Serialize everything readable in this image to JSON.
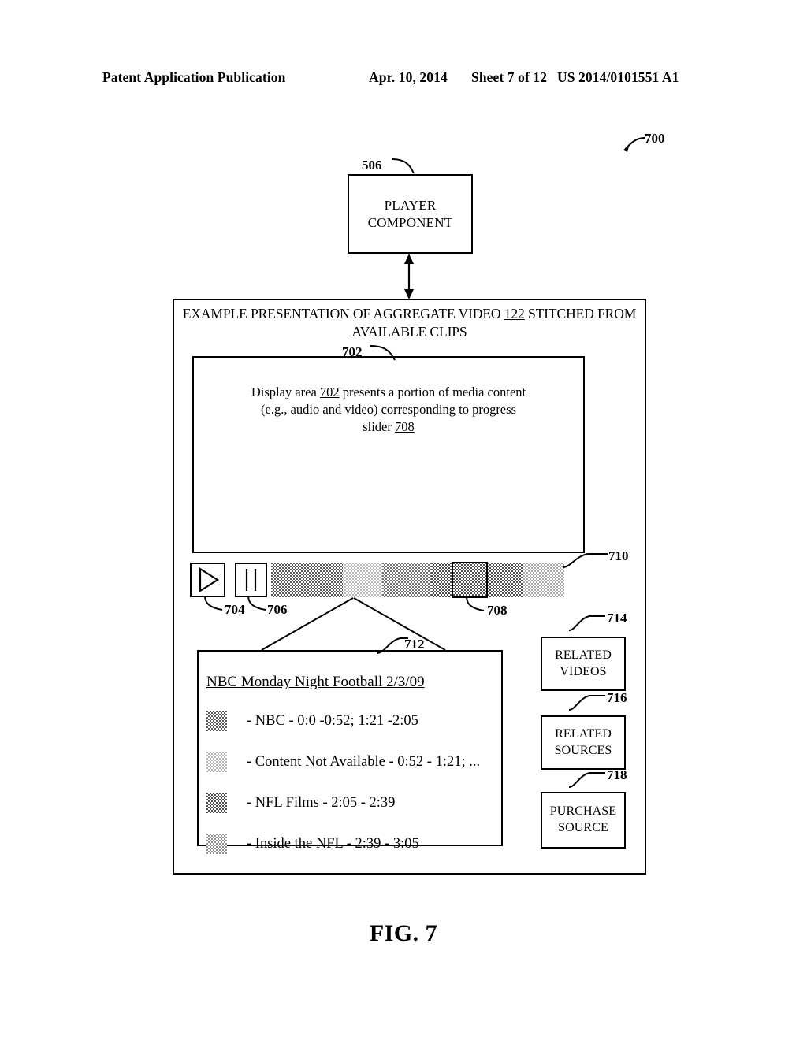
{
  "header": {
    "publication": "Patent Application Publication",
    "date": "Apr. 10, 2014",
    "sheet": "Sheet 7 of 12",
    "patent_number": "US 2014/0101551 A1"
  },
  "figure": {
    "caption": "FIG. 7",
    "ref": "700"
  },
  "player_component": {
    "ref": "506",
    "label": "PLAYER COMPONENT"
  },
  "presentation_panel": {
    "title_line1_a": "EXAMPLE PRESENTATION OF AGGREGATE VIDEO ",
    "title_line1_underlined": "122",
    "title_line1_b": " STITCHED FROM",
    "title_line2": "AVAILABLE CLIPS"
  },
  "display_area": {
    "ref": "702",
    "text_a": "Display area ",
    "text_ref1": "702",
    "text_b": " presents a portion of media content",
    "text_line2": "(e.g., audio and video) corresponding to progress",
    "text_line3_a": "slider ",
    "text_ref2": "708"
  },
  "controls": {
    "play": {
      "ref": "704",
      "icon": "play-triangle-icon"
    },
    "pause": {
      "ref": "706",
      "icon": "pause-bars-icon"
    },
    "progress_bar": {
      "ref": "710"
    },
    "progress_thumb": {
      "ref": "708"
    }
  },
  "progress_segments": [
    {
      "shade": "#595959",
      "width_pct": 24.5
    },
    {
      "shade": "#b8b8b8",
      "width_pct": 13.5
    },
    {
      "shade": "#6e6e6e",
      "width_pct": 16.5
    },
    {
      "shade": "#4a4a4a",
      "width_pct": 13.0
    },
    {
      "shade": "#4f4f4f",
      "width_pct": 18.5
    },
    {
      "shade": "#a8a8a8",
      "width_pct": 14.0
    }
  ],
  "legend": {
    "ref": "712",
    "title": "NBC Monday Night Football 2/3/09",
    "items": [
      {
        "swatch": "#5a5a5a",
        "text": "- NBC - 0:0 -0:52; 1:21 -2:05"
      },
      {
        "swatch": "#b5b5b5",
        "text": "- Content Not Available - 0:52 - 1:21; ..."
      },
      {
        "swatch": "#4d4d4d",
        "text": "- NFL Films - 2:05 - 2:39"
      },
      {
        "swatch": "#8f8f8f",
        "text": "- Inside the NFL - 2:39 - 3:05"
      }
    ]
  },
  "side_boxes": [
    {
      "ref": "714",
      "label": "RELATED VIDEOS"
    },
    {
      "ref": "716",
      "label": "RELATED SOURCES"
    },
    {
      "ref": "718",
      "label": "PURCHASE SOURCE"
    }
  ]
}
